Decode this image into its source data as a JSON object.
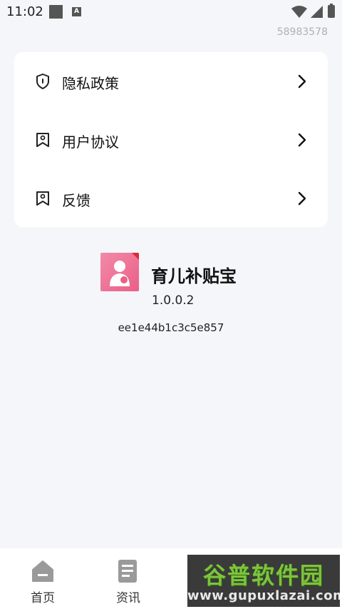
{
  "status_bar": {
    "time": "11:02",
    "notif_badge": "A"
  },
  "user_id": "58983578",
  "menu": {
    "items": [
      {
        "label": "隐私政策",
        "icon": "shield-icon"
      },
      {
        "label": "用户协议",
        "icon": "bookmark-icon"
      },
      {
        "label": "反馈",
        "icon": "bookmark-icon"
      }
    ]
  },
  "app": {
    "name": "育儿补贴宝",
    "version": "1.0.0.2",
    "hash": "ee1e44b1c3c5e857",
    "logo_color": "#ea5f88"
  },
  "bottom_nav": {
    "items": [
      {
        "label": "首页",
        "icon": "home-icon"
      },
      {
        "label": "资讯",
        "icon": "news-icon"
      }
    ]
  },
  "watermark": {
    "title": "谷普软件园",
    "url": "www.gupuxlazai.com"
  }
}
